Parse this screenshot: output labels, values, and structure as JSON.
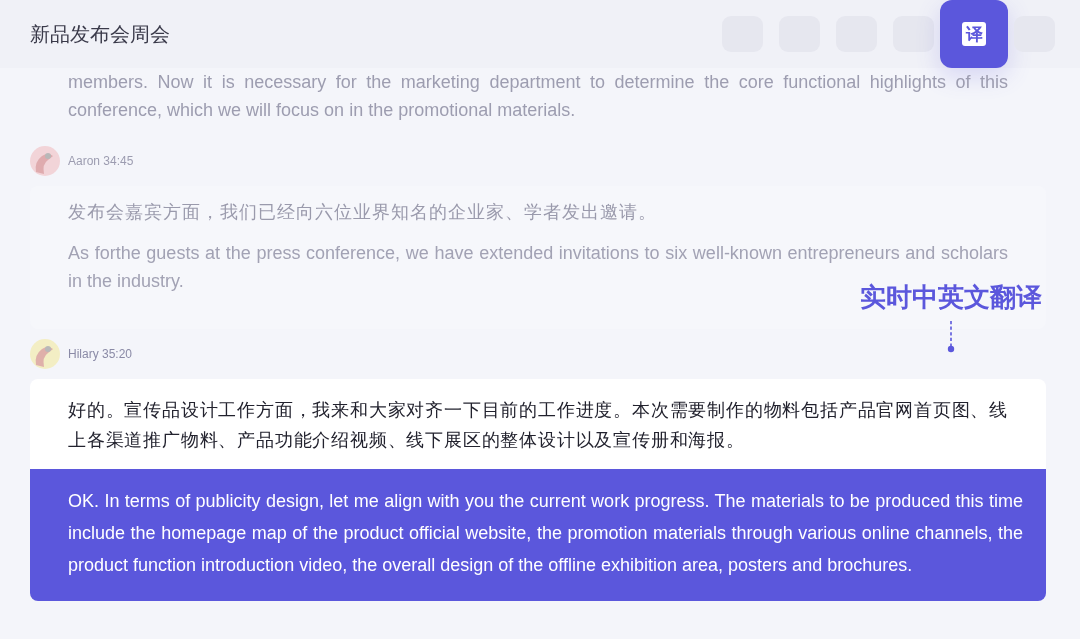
{
  "header": {
    "title": "新品发布会周会",
    "toolbar": [
      {
        "kind": "blank",
        "selected": false
      },
      {
        "kind": "blank",
        "selected": false
      },
      {
        "kind": "blank",
        "selected": false
      },
      {
        "kind": "blank",
        "selected": false
      },
      {
        "kind": "translate",
        "label": "译",
        "selected": true
      },
      {
        "kind": "blank",
        "selected": false
      }
    ]
  },
  "messages": [
    {
      "faded": true,
      "translation": "members. Now it is necessary for the marketing department to determine the core functional highlights of this conference, which we will focus on in the promotional materials."
    },
    {
      "faded": true,
      "author": "Aaron",
      "time": "34:45",
      "color": "#f2d4d8",
      "original": "发布会嘉宾方面，我们已经向六位业界知名的企业家、学者发出邀请。",
      "translation": "As forthe guests at the press conference, we have extended invitations to six well-known entrepreneurs and scholars in the industry."
    },
    {
      "faded": false,
      "author": "Hilary",
      "time": "35:20",
      "color": "#f3eec4",
      "original": "好的。宣传品设计工作方面，我来和大家对齐一下目前的工作进度。本次需要制作的物料包括产品官网首页图、线上各渠道推广物料、产品功能介绍视频、线下展区的整体设计以及宣传册和海报。",
      "translation": "OK. In terms of publicity design, let me align with you the current work progress. The materials to be produced this time include the homepage map of the product official website, the promotion materials through various online channels, the product function introduction video, the overall design of the offline exhibition area, posters and brochures."
    }
  ],
  "callout": {
    "text": "实时中英文翻译"
  }
}
